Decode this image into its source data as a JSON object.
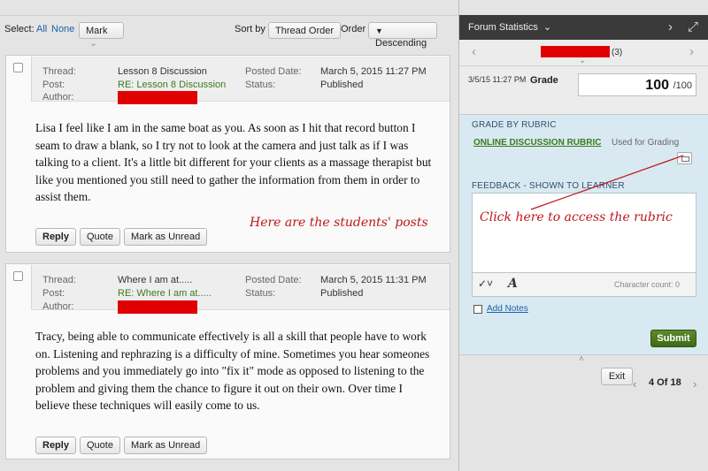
{
  "toolbar": {
    "select_label": "Select:",
    "select_all": "All",
    "select_none": "None",
    "mark_button": "Mark",
    "sort_label": "Sort by",
    "sort_value": "Thread Order",
    "order_label": "Order",
    "order_value": "Descending"
  },
  "posts": [
    {
      "thread_key": "Thread:",
      "thread": "Lesson 8 Discussion",
      "post_key": "Post:",
      "post": "RE: Lesson 8 Discussion",
      "author_key": "Author:",
      "posted_key": "Posted Date:",
      "posted": "March 5, 2015 11:27 PM",
      "status_key": "Status:",
      "status": "Published",
      "body": "Lisa I feel like I am in the same boat as you. As soon as I hit that record button I seam to draw a blank, so I try not to look at the camera and just talk as if I was talking to a client. It's a little bit different for your clients as a massage therapist but like you mentioned you still need to gather the information from them in order to assist them."
    },
    {
      "thread_key": "Thread:",
      "thread": "Where I am at.....",
      "post_key": "Post:",
      "post": "RE: Where I am at.....",
      "author_key": "Author:",
      "posted_key": "Posted Date:",
      "posted": "March 5, 2015 11:31 PM",
      "status_key": "Status:",
      "status": "Published",
      "body": "Tracy, being able to communicate effectively is all a skill that people have to work on. Listening and rephrazing is a difficulty of mine. Sometimes you hear someones problems and you immediately go into \"fix it\" mode as opposed to listening to the problem and giving them the chance to figure it out on their own. Over time I believe these techniques will easily come to us."
    }
  ],
  "actions": {
    "reply": "Reply",
    "quote": "Quote",
    "mark_unread": "Mark as Unread"
  },
  "annotations": {
    "posts_note": "Here are the students' posts",
    "rubric_note": "Click here to access the rubric"
  },
  "panel": {
    "title": "Forum Statistics",
    "count": "(3)",
    "date": "3/5/15 11:27 PM",
    "grade_label": "Grade",
    "grade_value": "100",
    "grade_max": "/100",
    "grade_by_rubric": "GRADE BY RUBRIC",
    "rubric_name": "ONLINE DISCUSSION RUBRIC",
    "used_for": "Used for Grading",
    "feedback_label": "FEEDBACK - SHOWN TO LEARNER",
    "char_count": "Character count: 0",
    "add_notes": "Add Notes",
    "submit": "Submit",
    "exit": "Exit",
    "pager": "4 Of 18"
  },
  "colors": {
    "redaction": "#e00000",
    "link_green": "#3b7a1e",
    "link_blue": "#1f5fa8",
    "annotation_red": "#c0171a",
    "panel_header": "#3a3a3a",
    "rubric_bg": "#d9e9f1",
    "submit_green": "#4d7a22"
  }
}
